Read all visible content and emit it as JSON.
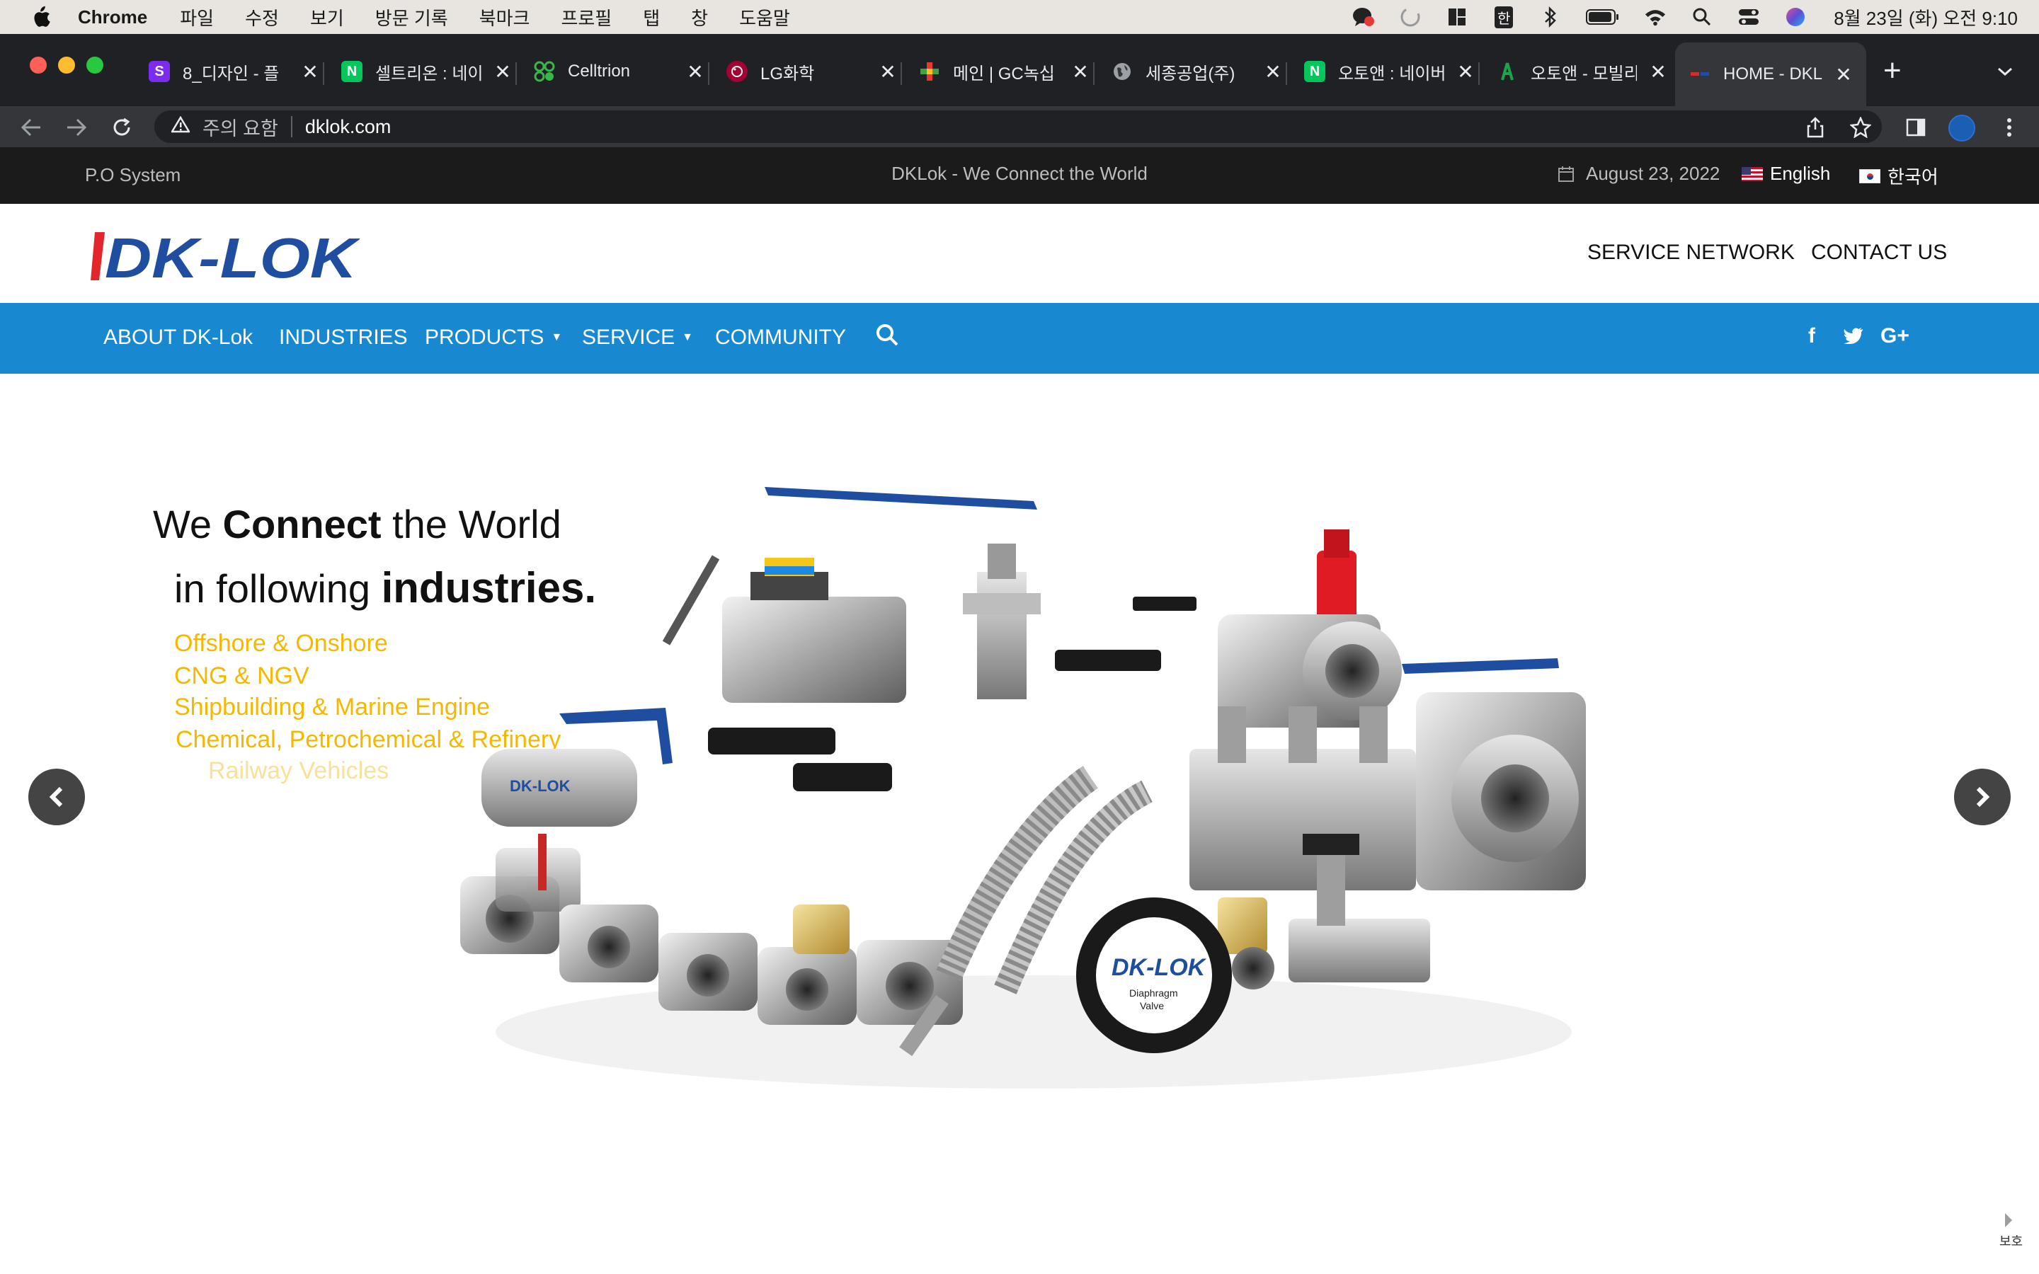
{
  "menubar": {
    "app_name": "Chrome",
    "items": [
      "파일",
      "수정",
      "보기",
      "방문 기록",
      "북마크",
      "프로필",
      "탭",
      "창",
      "도움말"
    ],
    "status_icons": [
      "chat-icon",
      "activity-icon",
      "layout-icon",
      "input-method-icon",
      "bluetooth-icon",
      "battery-icon",
      "wifi-icon",
      "search-icon",
      "control-center-icon",
      "siri-icon"
    ],
    "input_method": "한",
    "clock": "8월 23일 (화) 오전 9:10"
  },
  "tabs": [
    {
      "title": "8_디자인 - 플",
      "favicon": "S",
      "color": "#7b2cf0"
    },
    {
      "title": "셀트리온 : 네이",
      "favicon": "N",
      "color": "#03c75a"
    },
    {
      "title": "Celltrion",
      "favicon": "",
      "color": "#3ab54a"
    },
    {
      "title": "LG화학",
      "favicon": "",
      "color": "#a50034"
    },
    {
      "title": "메인 | GC녹십",
      "favicon": "",
      "color": "#e53935"
    },
    {
      "title": "세종공업(주)",
      "favicon": "",
      "color": "#9aa0a6"
    },
    {
      "title": "오토앤 : 네이버",
      "favicon": "N",
      "color": "#03c75a"
    },
    {
      "title": "오토앤 - 모빌리",
      "favicon": "",
      "color": "#1fa34a"
    },
    {
      "title": "HOME - DKL",
      "favicon": "",
      "color": "#d22e2e"
    }
  ],
  "omnibox": {
    "security_label": "주의 요함",
    "url": "dklok.com"
  },
  "site": {
    "topbar": {
      "po_system": "P.O System",
      "tagline": "DKLok - We Connect the World",
      "date": "August 23, 2022",
      "lang_en": "English",
      "lang_ko": "한국어"
    },
    "logo_text": "DK-LOK",
    "header_links": {
      "service_network": "SERVICE NETWORK",
      "contact_us": "CONTACT US"
    },
    "nav": {
      "about": "ABOUT DK-Lok",
      "industries": "INDUSTRIES",
      "products": "PRODUCTS",
      "service": "SERVICE",
      "community": "COMMUNITY"
    },
    "colors": {
      "nav_blue": "#1888d0",
      "logo_red": "#e3262b",
      "logo_blue": "#1f4ea1",
      "industry_yellow": "#f5b800"
    }
  },
  "hero": {
    "line1_a": "We ",
    "line1_b": "Connect",
    "line1_c": " the World",
    "line2_a": "in following ",
    "line2_b": "industries.",
    "industries": [
      "Offshore & Onshore",
      "CNG & NGV",
      "Shipbuilding & Marine Engine",
      "Chemical, Petrochemical & Refinery",
      "Railway Vehicles"
    ]
  },
  "corner_widget_text": "보호"
}
